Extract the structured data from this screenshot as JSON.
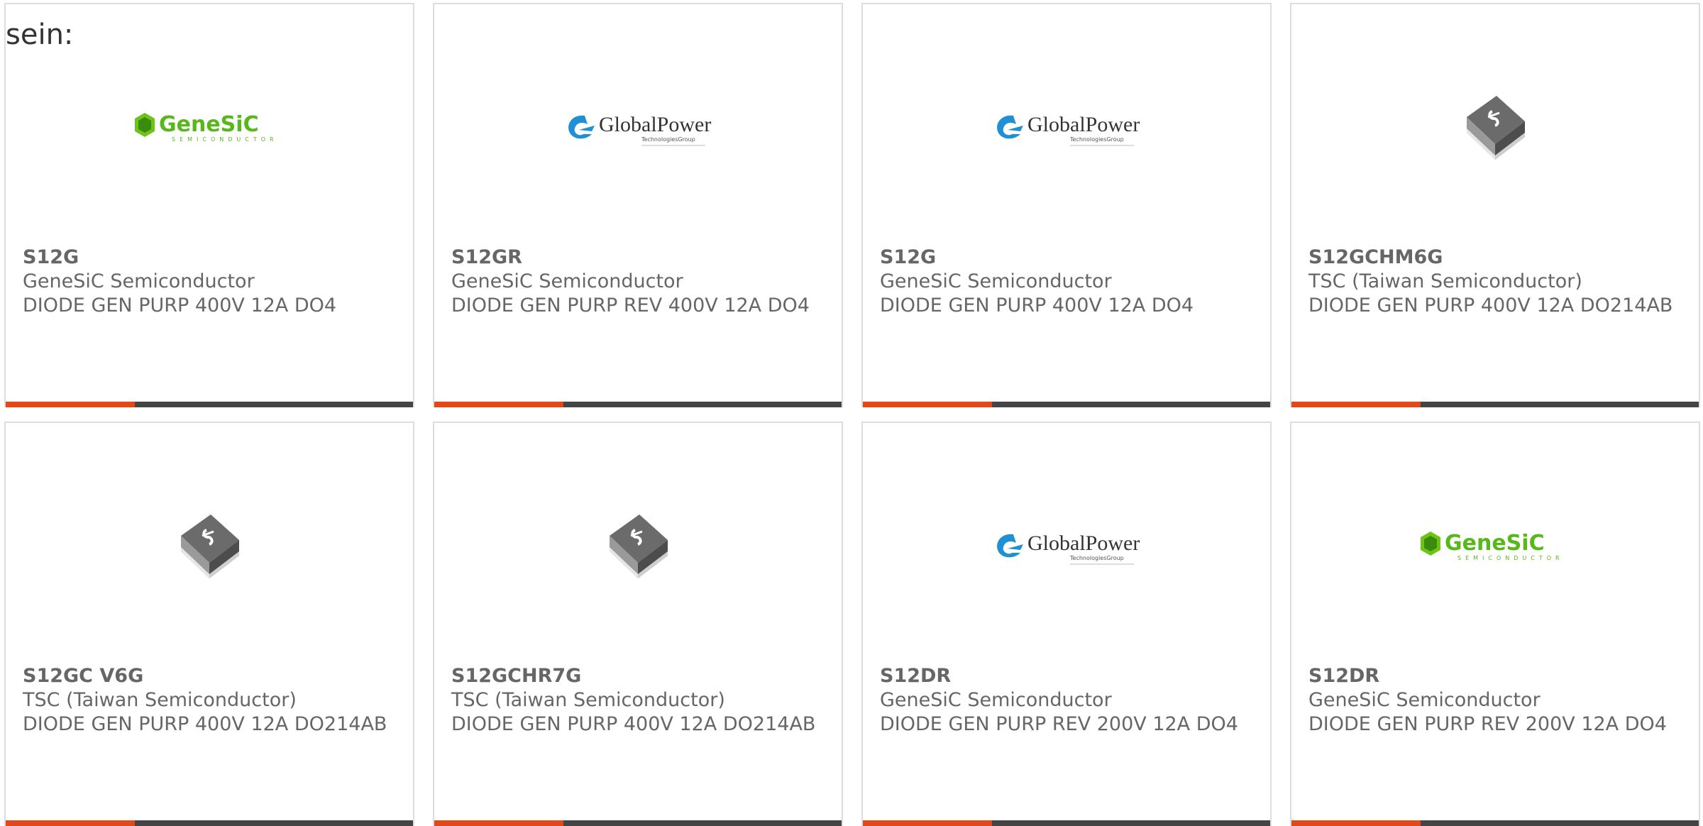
{
  "intro_text": "sein:",
  "colors": {
    "accent": "#e04a1a",
    "bar": "#444444",
    "border": "#dddddd",
    "text": "#666666"
  },
  "cards": [
    {
      "part": "S12G",
      "maker": "GeneSiC Semiconductor",
      "desc": "DIODE GEN PURP 400V 12A DO4",
      "image": "genesic-logo",
      "logo_main": "GeneSiC",
      "logo_sub": "SEMICONDUCTOR"
    },
    {
      "part": "S12GR",
      "maker": "GeneSiC Semiconductor",
      "desc": "DIODE GEN PURP REV 400V 12A DO4",
      "image": "globalpower-logo",
      "logo_main": "GlobalPower",
      "logo_sub": "TechnologiesGroup"
    },
    {
      "part": "S12G",
      "maker": "GeneSiC Semiconductor",
      "desc": "DIODE GEN PURP 400V 12A DO4",
      "image": "globalpower-logo",
      "logo_main": "GlobalPower",
      "logo_sub": "TechnologiesGroup"
    },
    {
      "part": "S12GCHM6G",
      "maker": "TSC (Taiwan Semiconductor)",
      "desc": "DIODE GEN PURP 400V 12A DO214AB",
      "image": "smd-package-icon"
    },
    {
      "part": "S12GC V6G",
      "maker": "TSC (Taiwan Semiconductor)",
      "desc": "DIODE GEN PURP 400V 12A DO214AB",
      "image": "smd-package-icon"
    },
    {
      "part": "S12GCHR7G",
      "maker": "TSC (Taiwan Semiconductor)",
      "desc": "DIODE GEN PURP 400V 12A DO214AB",
      "image": "smd-package-icon"
    },
    {
      "part": "S12DR",
      "maker": "GeneSiC Semiconductor",
      "desc": "DIODE GEN PURP REV 200V 12A DO4",
      "image": "globalpower-logo",
      "logo_main": "GlobalPower",
      "logo_sub": "TechnologiesGroup"
    },
    {
      "part": "S12DR",
      "maker": "GeneSiC Semiconductor",
      "desc": "DIODE GEN PURP REV 200V 12A DO4",
      "image": "genesic-logo",
      "logo_main": "GeneSiC",
      "logo_sub": "SEMICONDUCTOR"
    }
  ]
}
